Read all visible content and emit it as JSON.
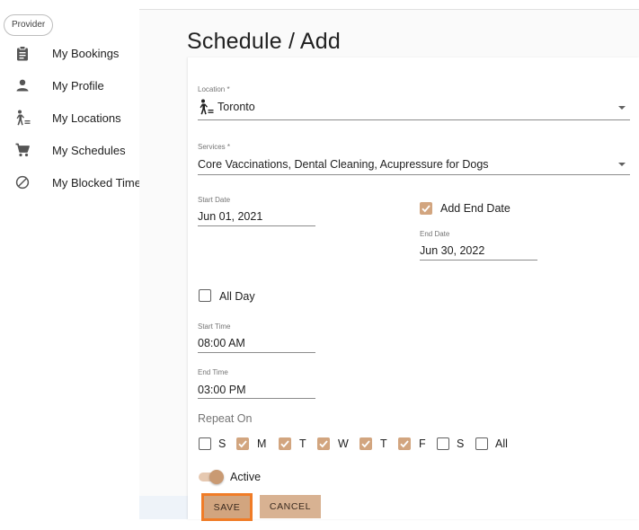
{
  "sidebar": {
    "chip": "Provider",
    "items": [
      {
        "label": "My Bookings",
        "icon": "clipboard-icon"
      },
      {
        "label": "My Profile",
        "icon": "person-icon"
      },
      {
        "label": "My Locations",
        "icon": "walker-icon"
      },
      {
        "label": "My Schedules",
        "icon": "cart-icon"
      },
      {
        "label": "My Blocked Times",
        "icon": "blocked-icon"
      }
    ]
  },
  "page": {
    "title": "Schedule / Add"
  },
  "form": {
    "location": {
      "label": "Location *",
      "value": "Toronto"
    },
    "services": {
      "label": "Services *",
      "value": "Core Vaccinations, Dental Cleaning, Acupressure for Dogs"
    },
    "start_date": {
      "label": "Start Date",
      "value": "Jun 01, 2021"
    },
    "add_end_date": {
      "label": "Add End Date",
      "checked": true
    },
    "end_date": {
      "label": "End Date",
      "value": "Jun 30, 2022"
    },
    "all_day": {
      "label": "All Day",
      "checked": false
    },
    "start_time": {
      "label": "Start Time",
      "value": "08:00 AM"
    },
    "end_time": {
      "label": "End Time",
      "value": "03:00 PM"
    },
    "repeat_on": {
      "label": "Repeat On",
      "days": [
        {
          "label": "S",
          "checked": false
        },
        {
          "label": "M",
          "checked": true
        },
        {
          "label": "T",
          "checked": true
        },
        {
          "label": "W",
          "checked": true
        },
        {
          "label": "T",
          "checked": true
        },
        {
          "label": "F",
          "checked": true
        },
        {
          "label": "S",
          "checked": false
        },
        {
          "label": "All",
          "checked": false
        }
      ]
    },
    "active": {
      "label": "Active",
      "on": true
    }
  },
  "buttons": {
    "save": "SAVE",
    "cancel": "CANCEL"
  },
  "colors": {
    "accent": "#d2a57f",
    "focus_outline": "#f07c27"
  }
}
